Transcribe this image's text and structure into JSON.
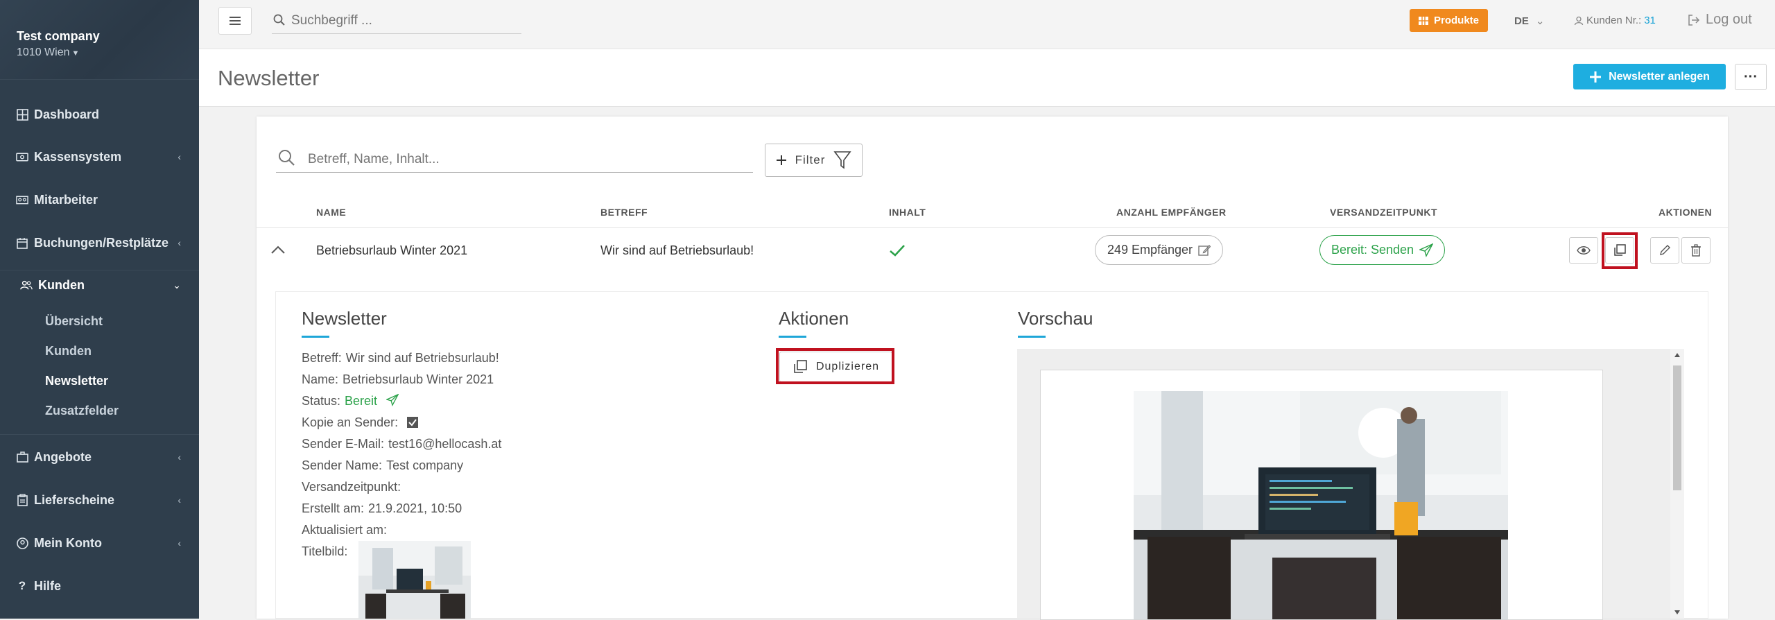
{
  "sidebar": {
    "company": "Test company",
    "city": "1010 Wien",
    "items": [
      {
        "label": "Dashboard"
      },
      {
        "label": "Kassensystem"
      },
      {
        "label": "Mitarbeiter"
      },
      {
        "label": "Buchungen/Restplätze"
      },
      {
        "label": "Kunden"
      },
      {
        "label": "Angebote"
      },
      {
        "label": "Lieferscheine"
      },
      {
        "label": "Mein Konto"
      },
      {
        "label": "Hilfe"
      }
    ],
    "subitems": [
      {
        "label": "Übersicht"
      },
      {
        "label": "Kunden"
      },
      {
        "label": "Newsletter"
      },
      {
        "label": "Zusatzfelder"
      }
    ]
  },
  "topbar": {
    "search_placeholder": "Suchbegriff ...",
    "produkte": "Produkte",
    "lang": "DE",
    "kunden_nr_label": "Kunden Nr.:",
    "kunden_nr": "31",
    "logout": "Log out"
  },
  "page": {
    "title": "Newsletter",
    "new_button": "Newsletter anlegen",
    "more": "···"
  },
  "list": {
    "search_placeholder": "Betreff, Name, Inhalt...",
    "filter": "Filter",
    "columns": {
      "name": "NAME",
      "betreff": "BETREFF",
      "inhalt": "INHALT",
      "empfaenger": "ANZAHL EMPFÄNGER",
      "versand": "VERSANDZEITPUNKT",
      "aktionen": "AKTIONEN"
    },
    "row": {
      "name": "Betriebsurlaub Winter 2021",
      "betreff": "Wir sind auf Betriebsurlaub!",
      "empfaenger": "249 Empfänger",
      "status": "Bereit: Senden"
    }
  },
  "detail": {
    "newsletter_title": "Newsletter",
    "aktionen_title": "Aktionen",
    "vorschau_title": "Vorschau",
    "duplizieren": "Duplizieren",
    "fields": {
      "betreff_label": "Betreff:",
      "betreff": "Wir sind auf Betriebsurlaub!",
      "name_label": "Name:",
      "name": "Betriebsurlaub Winter 2021",
      "status_label": "Status:",
      "status": "Bereit",
      "kopie_label": "Kopie an Sender:",
      "sender_email_label": "Sender E-Mail:",
      "sender_email": "test16@hellocash.at",
      "sender_name_label": "Sender Name:",
      "sender_name": "Test company",
      "versand_label": "Versandzeitpunkt:",
      "erstellt_label": "Erstellt am:",
      "erstellt": "21.9.2021, 10:50",
      "aktualisiert_label": "Aktualisiert am:",
      "titelbild_label": "Titelbild:"
    }
  },
  "colors": {
    "sidebar": "#2f3e4c",
    "accent_blue": "#1eaee0",
    "orange": "#f0891e",
    "green": "#2ca24a",
    "highlight_red": "#c0111f"
  }
}
